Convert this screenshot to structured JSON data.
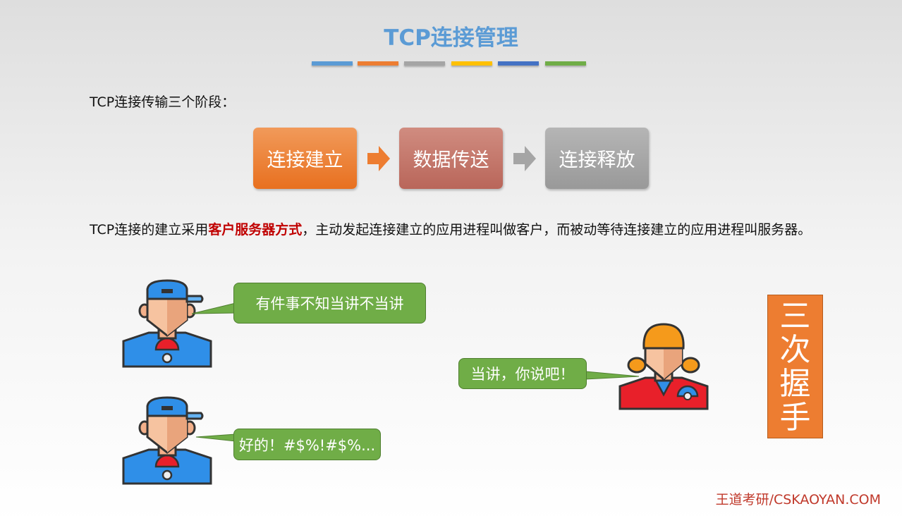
{
  "title": "TCP连接管理",
  "accent_bars": [
    "#5b9bd5",
    "#ed7d31",
    "#a5a5a5",
    "#ffc000",
    "#4472c4",
    "#70ad47"
  ],
  "intro": "TCP连接传输三个阶段：",
  "phases": [
    {
      "label": "连接建立",
      "color": "#ed7d31"
    },
    {
      "label": "数据传送",
      "color": "#c0705f"
    },
    {
      "label": "连接释放",
      "color": "#a5a5a5"
    }
  ],
  "paragraph": {
    "before": "TCP连接的建立采用",
    "highlight": "客户服务器方式",
    "after": "，主动发起连接建立的应用进程叫做客户，而被动等待连接建立的应用进程叫服务器。"
  },
  "dialog": [
    "有件事不知当讲不当讲",
    "当讲，你说吧！",
    "好的！#$%!#$%..."
  ],
  "handshake_label": "三次握手",
  "footer": "王道考研/CSKAOYAN.COM"
}
